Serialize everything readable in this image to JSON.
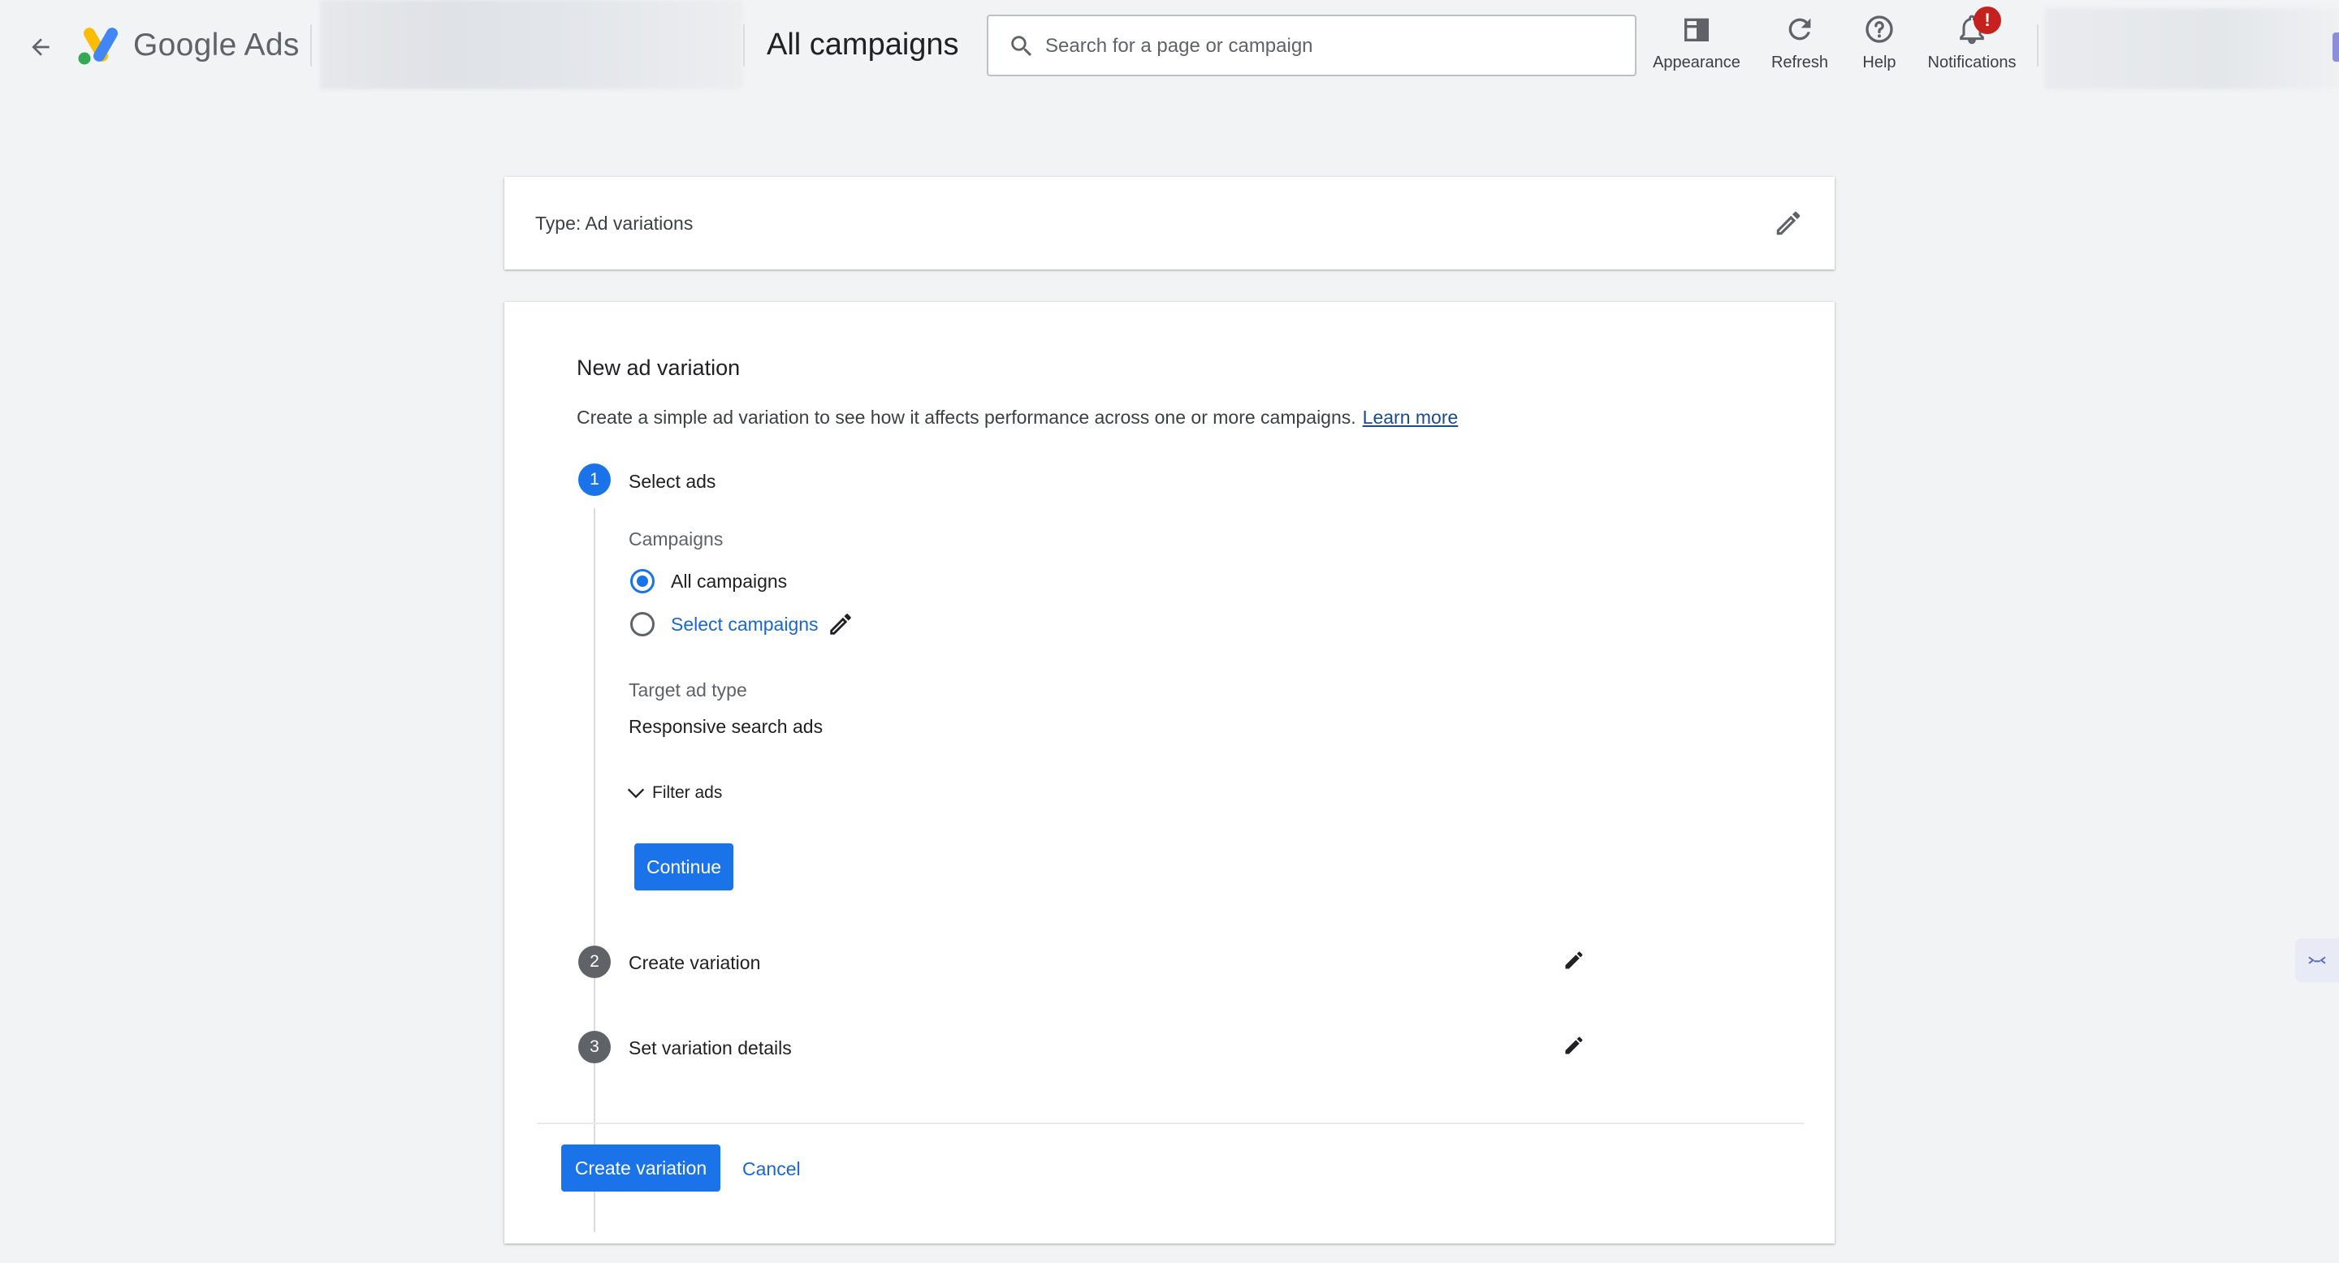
{
  "header": {
    "brand": "Google Ads",
    "page_title": "All campaigns",
    "search_placeholder": "Search for a page or campaign",
    "tools": [
      {
        "label": "Appearance",
        "icon": "appearance-icon"
      },
      {
        "label": "Refresh",
        "icon": "refresh-icon"
      },
      {
        "label": "Help",
        "icon": "help-icon"
      },
      {
        "label": "Notifications",
        "icon": "bell-icon",
        "badge": "!"
      }
    ]
  },
  "type_card": {
    "label": "Type: Ad variations"
  },
  "main": {
    "heading": "New ad variation",
    "description": "Create a simple ad variation to see how it affects performance across one or more campaigns.",
    "learn_more": "Learn more",
    "steps": [
      {
        "number": "1",
        "title": "Select ads",
        "state": "active"
      },
      {
        "number": "2",
        "title": "Create variation",
        "state": "inactive"
      },
      {
        "number": "3",
        "title": "Set variation details",
        "state": "inactive"
      }
    ],
    "campaigns_label": "Campaigns",
    "campaign_options": [
      {
        "label": "All campaigns",
        "selected": true
      },
      {
        "label": "Select campaigns",
        "selected": false
      }
    ],
    "target_ad_type_label": "Target ad type",
    "target_ad_type_value": "Responsive search ads",
    "filter_ads": "Filter ads",
    "continue": "Continue"
  },
  "footer": {
    "create_variation": "Create variation",
    "cancel": "Cancel"
  },
  "colors": {
    "accent": "#1a73e8",
    "link": "#1967d2",
    "badge": "#c5221f",
    "background": "#f1f3f4"
  }
}
